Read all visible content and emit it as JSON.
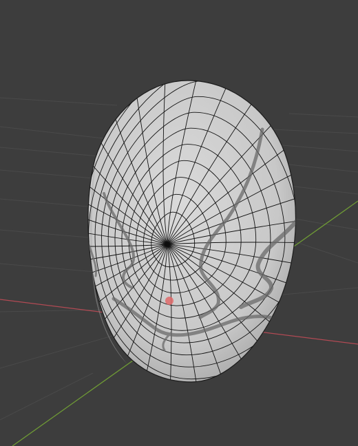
{
  "viewport": {
    "mode": "3D Viewport",
    "object": "ellipsoid-shield-mesh"
  },
  "colors": {
    "background": "#3d3d3d",
    "grid": "#4a4a4a",
    "x_axis": "#b34a54",
    "y_axis": "#6f9b35",
    "mesh_fill": "#c9c9c9",
    "wire": "#111111",
    "stroke_marks": "#6a6a6a",
    "origin_dot": "#e06a6a"
  },
  "icons": {
    "origin": "origin-icon",
    "pole": "mesh-pole-icon"
  }
}
